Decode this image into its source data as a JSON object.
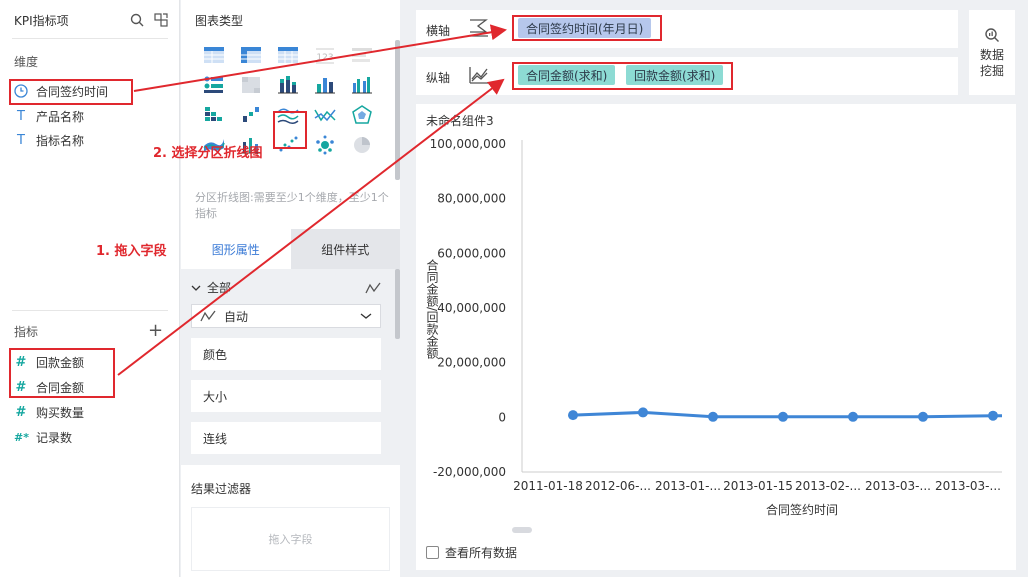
{
  "left_panel": {
    "title": "KPI指标项",
    "dimensions_title": "维度",
    "dimensions": [
      {
        "label": "合同签约时间",
        "icon": "clock-icon"
      },
      {
        "label": "产品名称",
        "icon": "text-type-icon"
      },
      {
        "label": "指标名称",
        "icon": "text-type-icon"
      }
    ],
    "metrics_title": "指标",
    "metrics": [
      {
        "label": "回款金额",
        "icon": "hash-icon"
      },
      {
        "label": "合同金额",
        "icon": "hash-icon"
      },
      {
        "label": "购买数量",
        "icon": "hash-icon"
      },
      {
        "label": "记录数",
        "icon": "hash-star-icon"
      }
    ],
    "type_glyph": "T",
    "hash_glyph": "#",
    "hash_star_glyph": "#*",
    "plus_glyph": "+"
  },
  "annotations": {
    "step1": "1. 拖入字段",
    "step2": "2. 选择分区折线图"
  },
  "chart_type_panel": {
    "title": "图表类型",
    "description": "分区折线图:需要至少1个维度，至少1个指标",
    "tabs": [
      "图形属性",
      "组件样式"
    ],
    "all_label": "全部",
    "auto_label": "自动",
    "props": [
      "颜色",
      "大小",
      "连线"
    ],
    "filter_title": "结果过滤器",
    "filter_placeholder": "拖入字段"
  },
  "shelves": {
    "x_label": "横轴",
    "y_label": "纵轴",
    "x_field": "合同签约时间(年月日)",
    "y_fields": [
      "合同金额(求和)",
      "回款金额(求和)"
    ]
  },
  "mine_button": {
    "line1": "数据",
    "line2": "挖掘"
  },
  "chart_panel": {
    "title": "未命名组件3",
    "view_all_label": "查看所有数据"
  },
  "chart_data": {
    "type": "line",
    "title": "",
    "xlabel": "合同签约时间",
    "ylabel": "合同金额/回款金额",
    "categories": [
      "2011-01-18",
      "2012-06-...",
      "2013-01-...",
      "2013-01-15",
      "2013-02-...",
      "2013-03-...",
      "2013-03-..."
    ],
    "series": [
      {
        "values": [
          800000,
          1800000,
          200000,
          200000,
          200000,
          200000,
          600000
        ]
      }
    ],
    "yticks": [
      "100,000,000",
      "80,000,000",
      "60,000,000",
      "40,000,000",
      "20,000,000",
      "0",
      "-20,000,000"
    ],
    "ylim": [
      -20000000,
      100000000
    ],
    "grid": false,
    "color": "#3f86d6"
  },
  "colors": {
    "accent_red": "#e0282e",
    "line_blue": "#3f86d6",
    "pill_blue": "#b6c7ec",
    "pill_teal": "#8ddbd4"
  }
}
